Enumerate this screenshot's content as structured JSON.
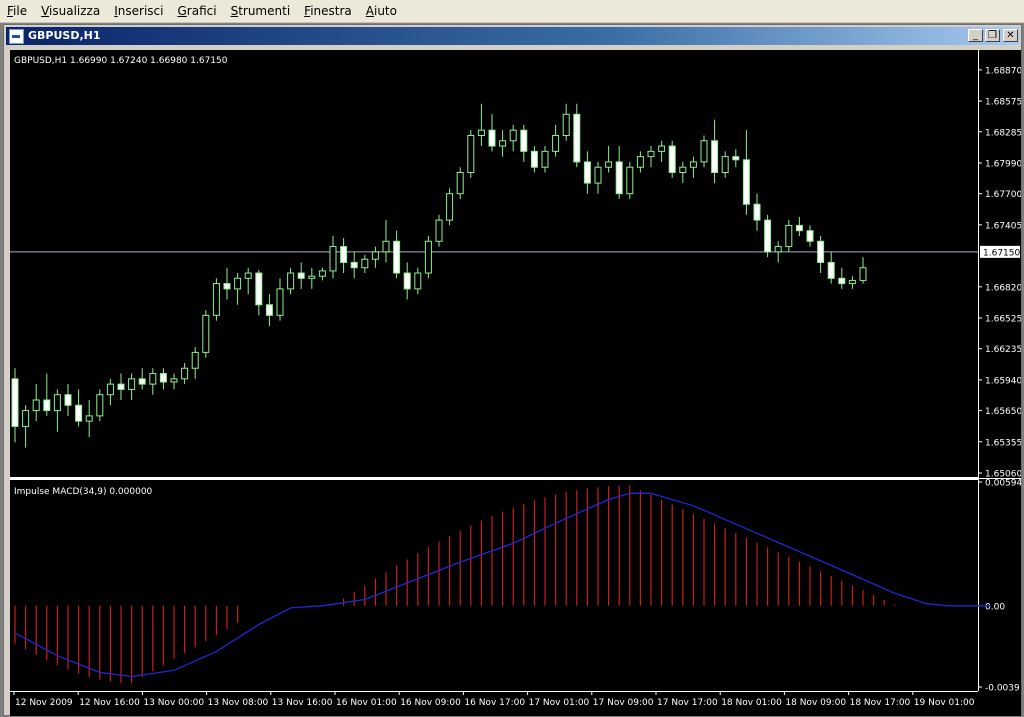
{
  "menu": {
    "items": [
      {
        "label": "File",
        "u": "F",
        "rest": "ile"
      },
      {
        "label": "Visualizza",
        "u": "V",
        "rest": "isualizza"
      },
      {
        "label": "Inserisci",
        "u": "I",
        "rest": "nserisci"
      },
      {
        "label": "Grafici",
        "u": "G",
        "rest": "rafici"
      },
      {
        "label": "Strumenti",
        "u": "S",
        "rest": "trumenti"
      },
      {
        "label": "Finestra",
        "u": "F",
        "rest": "inestra"
      },
      {
        "label": "Aiuto",
        "u": "A",
        "rest": "iuto"
      }
    ]
  },
  "window": {
    "title": "GBPUSD,H1",
    "minimize_icon": "minimize-icon",
    "maximize_icon": "restore-icon",
    "close_icon": "close-icon"
  },
  "colors": {
    "background": "#000000",
    "bull_candle": "#90ee90",
    "bear_candle": "#ffffff",
    "grid_line": "#ffffff",
    "bid_line": "#a9b1c9",
    "histogram": "#c81e1e",
    "signal": "#1e2ad2",
    "label_bg": "#ffffff"
  },
  "main_chart": {
    "info": "GBPUSD,H1  1.66990 1.67240 1.66980 1.67150",
    "current_price": "1.67150",
    "price_labels": [
      "1.68870",
      "1.68575",
      "1.68285",
      "1.67990",
      "1.67700",
      "1.67405",
      "1.66820",
      "1.66525",
      "1.66235",
      "1.65940",
      "1.65650",
      "1.65355",
      "1.65060"
    ]
  },
  "indicator": {
    "label": "Impulse MACD(34,9) 0.000000",
    "labels": [
      "0.005945",
      "0.00",
      "-0.0039"
    ]
  },
  "x_axis": {
    "labels": [
      "12 Nov 2009",
      "12 Nov 16:00",
      "13 Nov 00:00",
      "13 Nov 08:00",
      "13 Nov 16:00",
      "16 Nov 01:00",
      "16 Nov 09:00",
      "16 Nov 17:00",
      "17 Nov 01:00",
      "17 Nov 09:00",
      "17 Nov 17:00",
      "18 Nov 01:00",
      "18 Nov 09:00",
      "18 Nov 17:00",
      "19 Nov 01:00"
    ]
  },
  "chart_data": {
    "type": "candlestick",
    "symbol": "GBPUSD",
    "timeframe": "H1",
    "ylim": [
      1.6506,
      1.6902
    ],
    "current_price": 1.6715,
    "candles": [
      [
        1.6595,
        1.6605,
        1.6535,
        1.655
      ],
      [
        1.655,
        1.657,
        1.653,
        1.6565
      ],
      [
        1.6565,
        1.659,
        1.6555,
        1.6575
      ],
      [
        1.6575,
        1.66,
        1.656,
        1.6565
      ],
      [
        1.6565,
        1.6585,
        1.6545,
        1.658
      ],
      [
        1.658,
        1.659,
        1.656,
        1.657
      ],
      [
        1.657,
        1.6585,
        1.655,
        1.6555
      ],
      [
        1.6555,
        1.6575,
        1.654,
        1.656
      ],
      [
        1.656,
        1.6585,
        1.6555,
        1.658
      ],
      [
        1.658,
        1.6595,
        1.657,
        1.659
      ],
      [
        1.659,
        1.66,
        1.6575,
        1.6585
      ],
      [
        1.6585,
        1.66,
        1.6575,
        1.6595
      ],
      [
        1.6595,
        1.6605,
        1.6585,
        1.659
      ],
      [
        1.659,
        1.6605,
        1.658,
        1.66
      ],
      [
        1.66,
        1.6605,
        1.6585,
        1.6592
      ],
      [
        1.6592,
        1.66,
        1.6585,
        1.6595
      ],
      [
        1.6595,
        1.661,
        1.659,
        1.6605
      ],
      [
        1.6605,
        1.6625,
        1.6595,
        1.662
      ],
      [
        1.662,
        1.666,
        1.6615,
        1.6655
      ],
      [
        1.6655,
        1.669,
        1.665,
        1.6685
      ],
      [
        1.6685,
        1.67,
        1.667,
        1.668
      ],
      [
        1.668,
        1.6695,
        1.6665,
        1.669
      ],
      [
        1.669,
        1.67,
        1.6675,
        1.6695
      ],
      [
        1.6695,
        1.6698,
        1.6655,
        1.6665
      ],
      [
        1.6665,
        1.6675,
        1.6645,
        1.6655
      ],
      [
        1.6655,
        1.669,
        1.665,
        1.668
      ],
      [
        1.668,
        1.67,
        1.6675,
        1.6695
      ],
      [
        1.6695,
        1.6705,
        1.668,
        1.669
      ],
      [
        1.669,
        1.67,
        1.668,
        1.6692
      ],
      [
        1.6692,
        1.67,
        1.6688,
        1.6697
      ],
      [
        1.6697,
        1.673,
        1.669,
        1.672
      ],
      [
        1.672,
        1.6728,
        1.6695,
        1.6705
      ],
      [
        1.6705,
        1.6715,
        1.669,
        1.67
      ],
      [
        1.67,
        1.6712,
        1.6695,
        1.6708
      ],
      [
        1.6708,
        1.672,
        1.67,
        1.6715
      ],
      [
        1.6715,
        1.6745,
        1.6705,
        1.6725
      ],
      [
        1.6725,
        1.6735,
        1.669,
        1.6695
      ],
      [
        1.6695,
        1.6705,
        1.667,
        1.668
      ],
      [
        1.668,
        1.67,
        1.6675,
        1.6695
      ],
      [
        1.6695,
        1.673,
        1.669,
        1.6725
      ],
      [
        1.6725,
        1.675,
        1.672,
        1.6745
      ],
      [
        1.6745,
        1.6775,
        1.674,
        1.677
      ],
      [
        1.677,
        1.6795,
        1.6765,
        1.679
      ],
      [
        1.679,
        1.683,
        1.6785,
        1.6825
      ],
      [
        1.6825,
        1.6855,
        1.6815,
        1.683
      ],
      [
        1.683,
        1.6845,
        1.681,
        1.6815
      ],
      [
        1.6815,
        1.683,
        1.6805,
        1.682
      ],
      [
        1.682,
        1.6835,
        1.681,
        1.683
      ],
      [
        1.683,
        1.6835,
        1.68,
        1.681
      ],
      [
        1.681,
        1.6815,
        1.679,
        1.6795
      ],
      [
        1.6795,
        1.6815,
        1.679,
        1.681
      ],
      [
        1.681,
        1.6835,
        1.6805,
        1.6825
      ],
      [
        1.6825,
        1.6855,
        1.682,
        1.6845
      ],
      [
        1.6845,
        1.6855,
        1.6795,
        1.68
      ],
      [
        1.68,
        1.681,
        1.677,
        1.678
      ],
      [
        1.678,
        1.68,
        1.677,
        1.6795
      ],
      [
        1.6795,
        1.6815,
        1.679,
        1.68
      ],
      [
        1.68,
        1.6815,
        1.6765,
        1.677
      ],
      [
        1.677,
        1.68,
        1.6765,
        1.6795
      ],
      [
        1.6795,
        1.681,
        1.679,
        1.6805
      ],
      [
        1.6805,
        1.6815,
        1.6795,
        1.681
      ],
      [
        1.681,
        1.682,
        1.68,
        1.6815
      ],
      [
        1.6815,
        1.682,
        1.6785,
        1.679
      ],
      [
        1.679,
        1.68,
        1.678,
        1.6795
      ],
      [
        1.6795,
        1.6805,
        1.6785,
        1.68
      ],
      [
        1.68,
        1.6825,
        1.6795,
        1.682
      ],
      [
        1.682,
        1.684,
        1.678,
        1.679
      ],
      [
        1.679,
        1.681,
        1.6785,
        1.6805
      ],
      [
        1.6805,
        1.6812,
        1.6795,
        1.6802
      ],
      [
        1.6802,
        1.683,
        1.675,
        1.676
      ],
      [
        1.676,
        1.677,
        1.6735,
        1.6745
      ],
      [
        1.6745,
        1.675,
        1.671,
        1.6715
      ],
      [
        1.6715,
        1.6725,
        1.6705,
        1.672
      ],
      [
        1.672,
        1.6745,
        1.6715,
        1.674
      ],
      [
        1.674,
        1.6748,
        1.673,
        1.6735
      ],
      [
        1.6735,
        1.674,
        1.672,
        1.6725
      ],
      [
        1.6725,
        1.673,
        1.6695,
        1.6705
      ],
      [
        1.6705,
        1.6715,
        1.6685,
        1.669
      ],
      [
        1.669,
        1.67,
        1.668,
        1.6685
      ],
      [
        1.6685,
        1.6692,
        1.668,
        1.6688
      ],
      [
        1.6688,
        1.671,
        1.6685,
        1.67
      ]
    ]
  },
  "macd_data": {
    "type": "histogram+line",
    "ylim": [
      -0.0039,
      0.005945
    ],
    "hist_start": [
      0,
      0
    ],
    "hist_segments": [
      {
        "from": 0,
        "to": 21,
        "start": -0.00182,
        "peak": -0.00372,
        "peak_at": 11,
        "end": -0.00082
      },
      {
        "from": 30,
        "to": 83,
        "start": 2e-05,
        "peak": 0.00578,
        "peak_at": 58,
        "end": 6e-05
      }
    ],
    "signal_points": [
      [
        0,
        -0.0013
      ],
      [
        4,
        -0.0024
      ],
      [
        8,
        -0.0032
      ],
      [
        11,
        -0.0034
      ],
      [
        15,
        -0.0031
      ],
      [
        19,
        -0.0022
      ],
      [
        23,
        -0.0009
      ],
      [
        26,
        -0.0001
      ],
      [
        29,
        0.0
      ],
      [
        33,
        0.0003
      ],
      [
        37,
        0.0011
      ],
      [
        42,
        0.0021
      ],
      [
        47,
        0.003
      ],
      [
        52,
        0.0042
      ],
      [
        56,
        0.0051
      ],
      [
        58,
        0.0054
      ],
      [
        60,
        0.0054
      ],
      [
        64,
        0.0048
      ],
      [
        69,
        0.0037
      ],
      [
        74,
        0.0026
      ],
      [
        79,
        0.0015
      ],
      [
        83,
        0.0006
      ],
      [
        86,
        0.0001
      ],
      [
        88,
        0.0
      ],
      [
        92,
        0.0
      ]
    ]
  }
}
